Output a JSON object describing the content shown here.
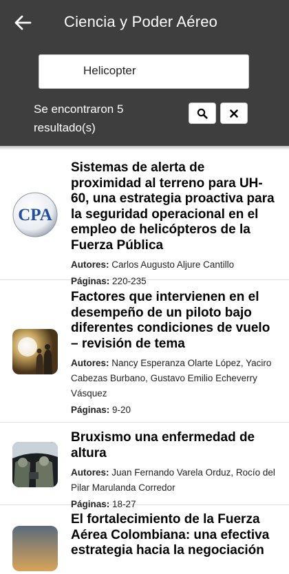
{
  "header": {
    "title": "Ciencia y Poder Aéreo",
    "search_value": "Helicopter",
    "result_count": "Se encontraron 5 resultado(s)"
  },
  "labels": {
    "authors": "Autores:",
    "pages": "Páginas:"
  },
  "results": [
    {
      "title": "Sistemas de alerta de proximidad al terreno para UH-60, una estrategia proactiva para la seguridad operacional en el empleo de helicópteros de la Fuerza Pública",
      "authors": "Carlos Augusto Aljure Cantillo",
      "pages": "220-235",
      "thumb_text": "CPA"
    },
    {
      "title": "Factores que intervienen en el desempeño de un piloto bajo diferentes condiciones de vuelo – revisión de tema",
      "authors": "Nancy Esperanza Olarte López, Yaciro Cabezas Burbano, Gustavo Emilio Echeverry Vásquez",
      "pages": "9-20"
    },
    {
      "title": "Bruxismo una enfermedad de altura",
      "authors": "Juan Fernando Varela Orduz, Rocío del Pilar Marulanda Corredor",
      "pages": "18-27"
    },
    {
      "title": "El fortalecimiento de la Fuerza Aérea Colombiana: una efectiva estrategia hacia la negociación"
    }
  ],
  "colors": {
    "header_bg": "#3e3e3e",
    "cpa_blue": "#1f4fa3"
  }
}
